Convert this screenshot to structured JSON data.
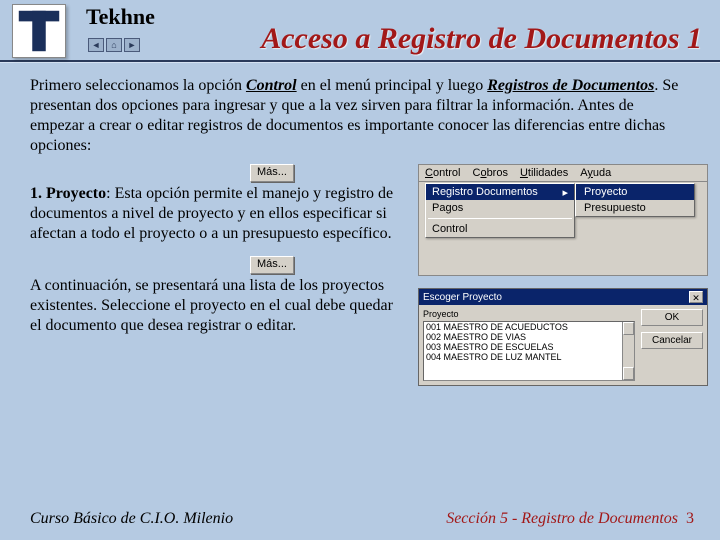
{
  "header": {
    "brand": "Tekhne",
    "title": "Acceso a Registro de Documentos 1"
  },
  "intro": {
    "p1a": "Primero seleccionamos la opción ",
    "control": "Control",
    "p1b": " en el menú principal y luego ",
    "reg": "Registros de Documentos",
    "p1c": ". Se presentan dos opciones para ingresar y que a la vez sirven para filtrar la información. Antes de empezar a crear o editar registros de documentos es importante conocer las diferencias entre dichas opciones:"
  },
  "mas_label": "Más...",
  "block1": {
    "lead": "1. Proyecto",
    "text": ": Esta opción permite el manejo y registro de documentos a nivel de proyecto y en ellos especificar si afectan a todo el proyecto o a un presupuesto específico."
  },
  "block2": {
    "text": "A continuación, se presentará una lista de los proyectos existentes. Seleccione el proyecto en el cual debe quedar el documento que desea registrar o editar."
  },
  "menu": {
    "bar": [
      "Control",
      "Cobros",
      "Utilidades",
      "Ayuda"
    ],
    "items": [
      "Registro Documentos",
      "Pagos",
      "Control"
    ],
    "sub": [
      "Proyecto",
      "Presupuesto"
    ]
  },
  "dialog": {
    "title": "Escoger Proyecto",
    "label": "Proyecto",
    "rows": [
      "001 MAESTRO DE ACUEDUCTOS",
      "002 MAESTRO DE VIAS",
      "003 MAESTRO DE ESCUELAS",
      "004 MAESTRO DE LUZ MANTEL"
    ],
    "ok": "OK",
    "cancel": "Cancelar"
  },
  "footer": {
    "left": "Curso Básico de C.I.O. Milenio",
    "right": "Sección 5 - Registro de Documentos",
    "page": "3"
  }
}
